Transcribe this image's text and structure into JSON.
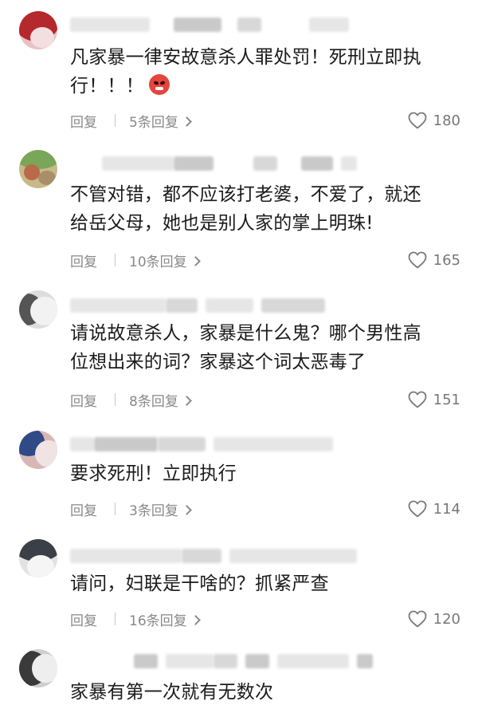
{
  "comments": [
    {
      "text_lines": [
        "凡家暴一律安故意杀人罪处罚！死刑立即执",
        "行！！！"
      ],
      "has_emoji": true,
      "emoji": "angry-face-icon",
      "reply_label": "回复",
      "replies_label": "5条回复",
      "likes": "180",
      "avatar_colors": [
        "#b5282d",
        "#e8c2c4"
      ]
    },
    {
      "text_lines": [
        "不管对错，都不应该打老婆，不爱了，就还",
        "给岳父母，她也是别人家的掌上明珠!"
      ],
      "has_emoji": false,
      "reply_label": "回复",
      "replies_label": "10条回复",
      "likes": "165",
      "avatar_colors": [
        "#7aa65a",
        "#c9b98a"
      ]
    },
    {
      "text_lines": [
        "请说故意杀人，家暴是什么鬼？哪个男性高",
        "位想出来的词？家暴这个词太恶毒了"
      ],
      "has_emoji": false,
      "reply_label": "回复",
      "replies_label": "8条回复",
      "likes": "151",
      "avatar_colors": [
        "#555555",
        "#dddddd"
      ]
    },
    {
      "text_lines": [
        "要求死刑！立即执行"
      ],
      "has_emoji": false,
      "reply_label": "回复",
      "replies_label": "3条回复",
      "likes": "114",
      "avatar_colors": [
        "#2f4a86",
        "#d9b6b6"
      ]
    },
    {
      "text_lines": [
        "请问，妇联是干啥的？抓紧严查"
      ],
      "has_emoji": false,
      "reply_label": "回复",
      "replies_label": "16条回复",
      "likes": "120",
      "avatar_colors": [
        "#3b3f47",
        "#e2e2e2"
      ]
    },
    {
      "text_lines": [
        "家暴有第一次就有无数次"
      ],
      "has_emoji": false,
      "reply_label": "",
      "replies_label": "",
      "likes": "",
      "avatar_colors": [
        "#3a3a3a",
        "#cfcfcf"
      ]
    }
  ],
  "colors": {
    "text": "#1b1b1b",
    "secondary": "#888888",
    "like_icon": "#777777",
    "emoji": "#e5453c"
  },
  "icons": {
    "like": "heart-outline-icon",
    "replies_chevron": "chevron-right-icon"
  }
}
